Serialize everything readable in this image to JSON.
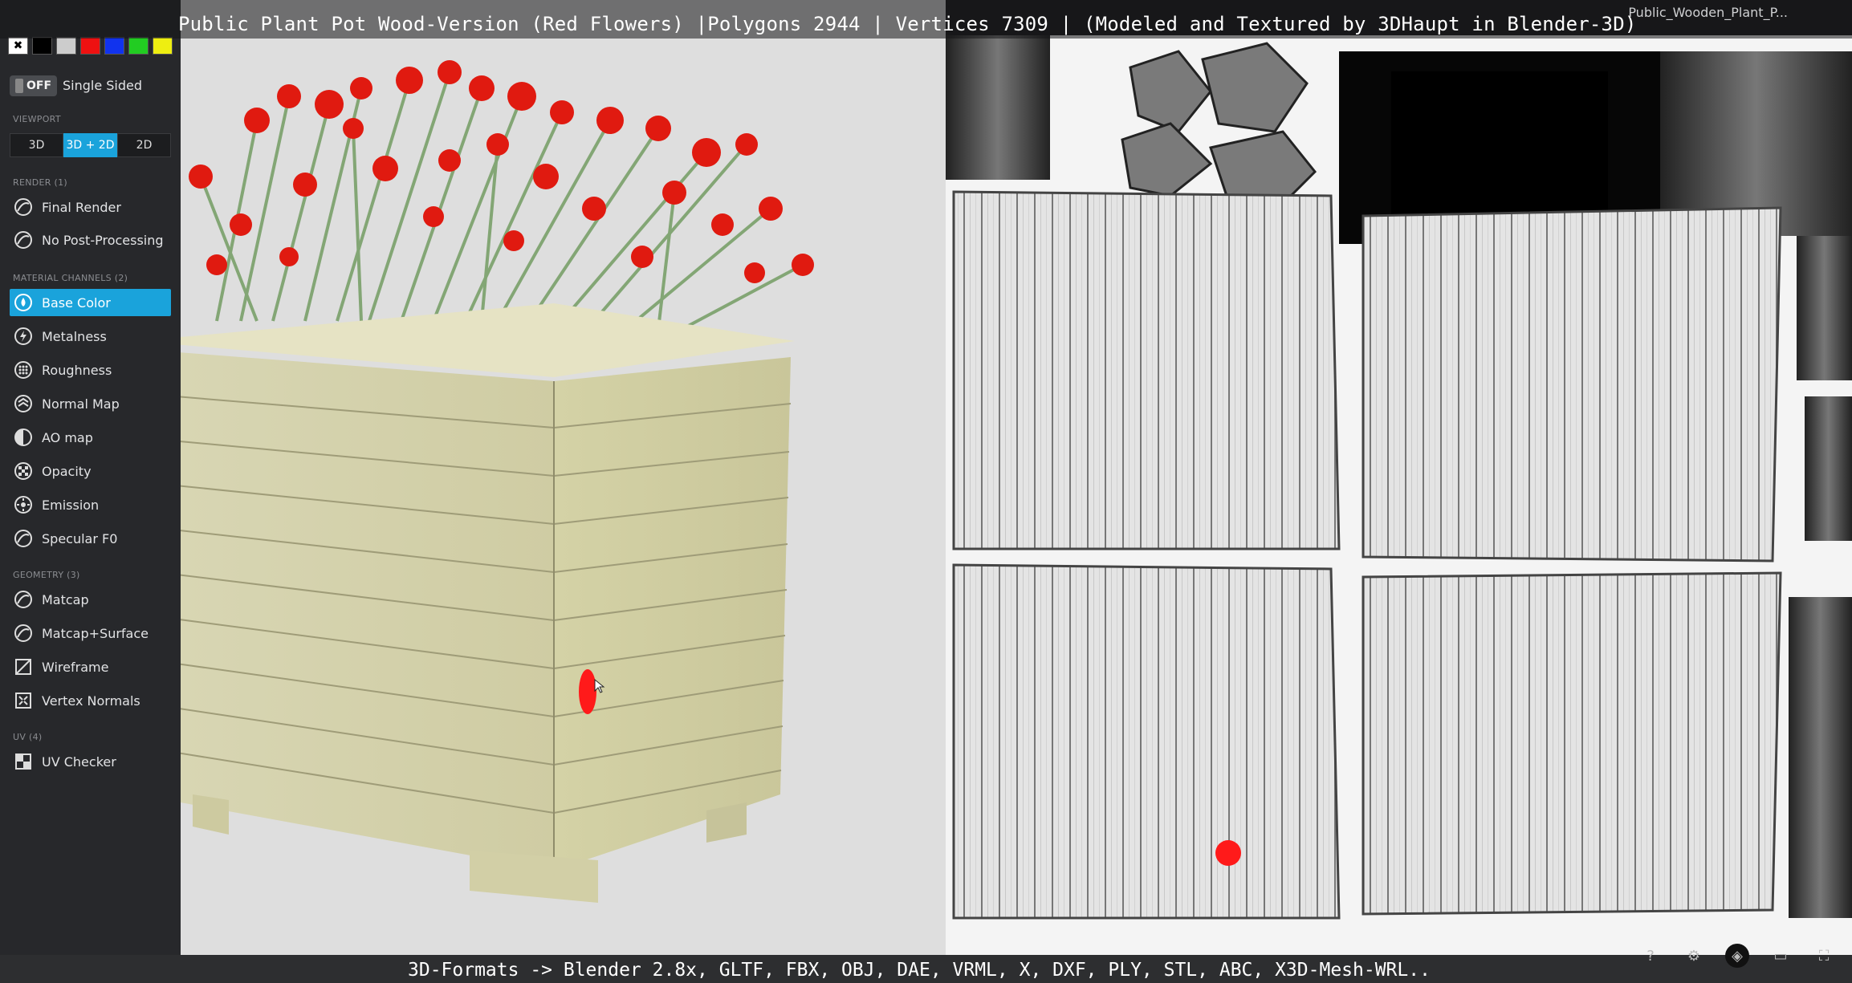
{
  "title_overlay": "Public Plant Pot Wood-Version (Red Flowers) |Polygons 2944 | Vertices 7309 | (Modeled and Textured by 3DHaupt in Blender-3D)",
  "bottom_overlay": "3D-Formats -> Blender 2.8x, GLTF, FBX, OBJ, DAE, VRML, X, DXF, PLY, STL, ABC, X3D-Mesh-WRL..",
  "model_name": "Public_Wooden_Plant_P...",
  "colors": {
    "accent": "#1aa3db",
    "panel": "#27282b",
    "title_overlay_bg": "#141416"
  },
  "sidebar": {
    "wireframe_swatches": [
      "#ffffff",
      "#000000",
      "#cccccc",
      "#ee1111",
      "#1133ee",
      "#22cc22",
      "#eeee11"
    ],
    "single_sided": {
      "state": "OFF",
      "label": "Single Sided"
    },
    "viewport": {
      "label": "VIEWPORT",
      "buttons": [
        "3D",
        "3D + 2D",
        "2D"
      ],
      "active": "3D + 2D"
    },
    "render": {
      "label": "RENDER (1)",
      "items": [
        "Final Render",
        "No Post-Processing"
      ]
    },
    "material": {
      "label": "MATERIAL CHANNELS (2)",
      "items": [
        "Base Color",
        "Metalness",
        "Roughness",
        "Normal Map",
        "AO map",
        "Opacity",
        "Emission",
        "Specular F0"
      ],
      "active": "Base Color"
    },
    "geometry": {
      "label": "GEOMETRY (3)",
      "items": [
        "Matcap",
        "Matcap+Surface",
        "Wireframe",
        "Vertex Normals"
      ]
    },
    "uv": {
      "label": "UV (4)",
      "items": [
        "UV Checker"
      ]
    }
  },
  "icons": [
    "help-icon",
    "settings-icon",
    "layers-icon",
    "vr-icon",
    "fullscreen-icon"
  ]
}
